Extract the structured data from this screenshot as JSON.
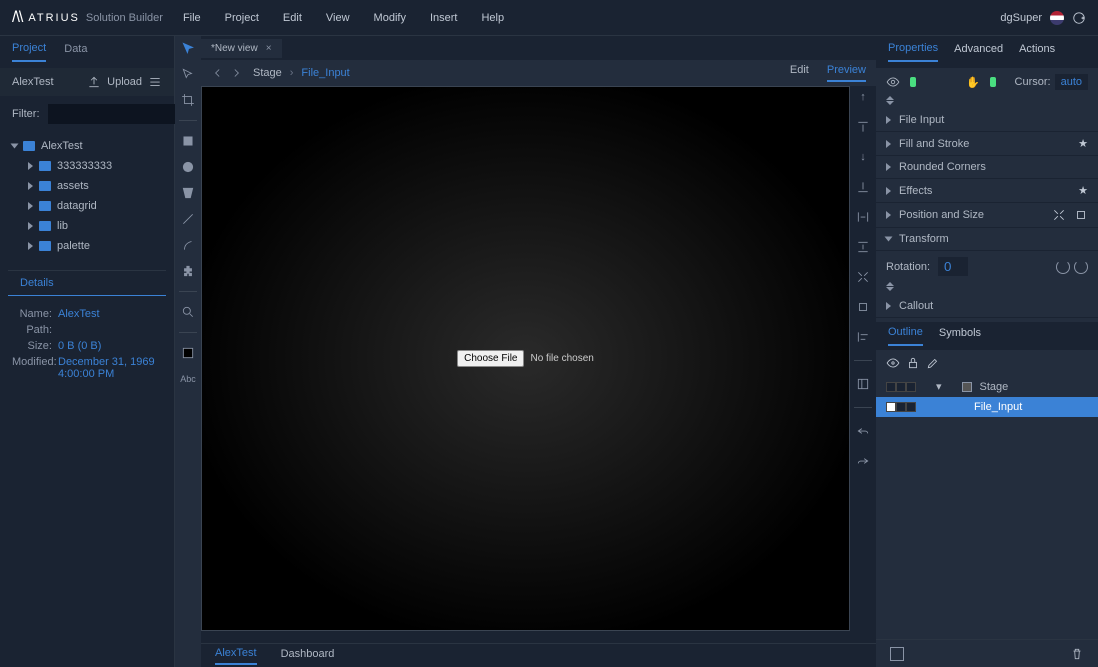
{
  "app": {
    "brand": "ATRIUS",
    "product": "Solution Builder",
    "user": "dgSuper"
  },
  "menubar": [
    "File",
    "Project",
    "Edit",
    "View",
    "Modify",
    "Insert",
    "Help"
  ],
  "sidebar": {
    "tabs": [
      "Project",
      "Data"
    ],
    "header": "AlexTest",
    "upload": "Upload",
    "filter_label": "Filter:",
    "tree": {
      "root": "AlexTest",
      "children": [
        "333333333",
        "assets",
        "datagrid",
        "lib",
        "palette"
      ]
    },
    "details": {
      "title": "Details",
      "name_lbl": "Name:",
      "name": "AlexTest",
      "path_lbl": "Path:",
      "path": "",
      "size_lbl": "Size:",
      "size": "0 B (0 B)",
      "modified_lbl": "Modified:",
      "modified": "December 31, 1969 4:00:00 PM"
    }
  },
  "doc": {
    "tab": "*New view",
    "breadcrumb": [
      "Stage",
      "File_Input"
    ],
    "actions": [
      "Edit",
      "Preview"
    ]
  },
  "file_input": {
    "button": "Choose File",
    "status": "No file chosen"
  },
  "bottom_tabs": [
    "AlexTest",
    "Dashboard"
  ],
  "right": {
    "tabs": [
      "Properties",
      "Advanced",
      "Actions"
    ],
    "cursor_label": "Cursor:",
    "cursor_value": "auto",
    "sections": {
      "file_input": "File Input",
      "fill_stroke": "Fill and Stroke",
      "rounded": "Rounded Corners",
      "effects": "Effects",
      "pos_size": "Position and Size",
      "transform": "Transform",
      "callout": "Callout"
    },
    "rotation_label": "Rotation:",
    "rotation_value": "0",
    "outline_tabs": [
      "Outline",
      "Symbols"
    ],
    "outline_items": {
      "stage": "Stage",
      "file_input": "File_Input"
    }
  }
}
